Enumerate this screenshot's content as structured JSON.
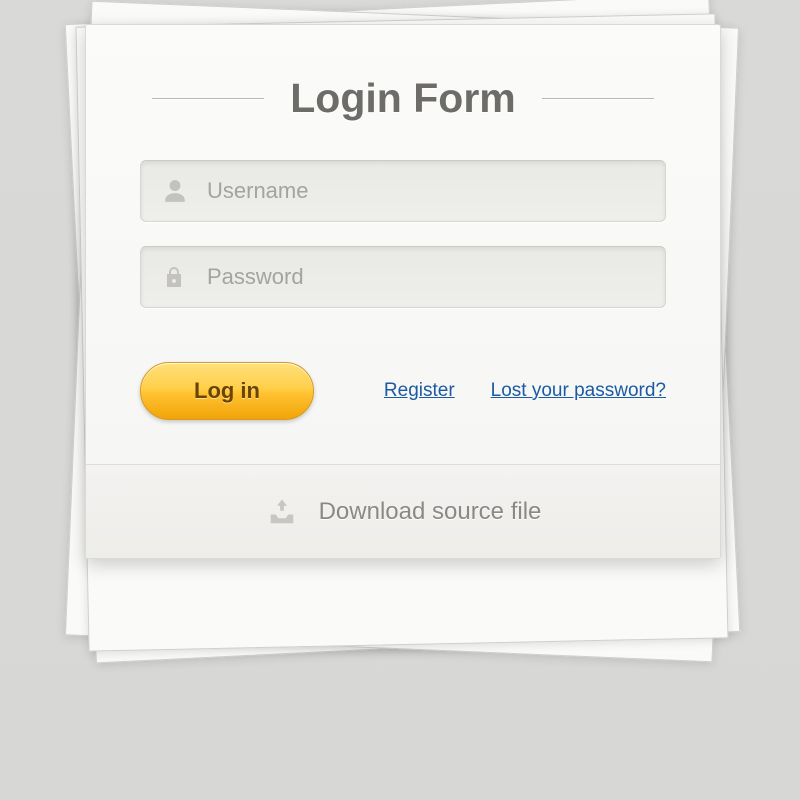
{
  "title": "Login Form",
  "fields": {
    "username": {
      "placeholder": "Username",
      "value": ""
    },
    "password": {
      "placeholder": "Password",
      "value": ""
    }
  },
  "actions": {
    "login_label": "Log in",
    "register_label": "Register",
    "lost_password_label": "Lost your password?"
  },
  "footer": {
    "download_label": "Download source file"
  },
  "colors": {
    "accent": "#ffc230",
    "link": "#1b5ba3"
  }
}
